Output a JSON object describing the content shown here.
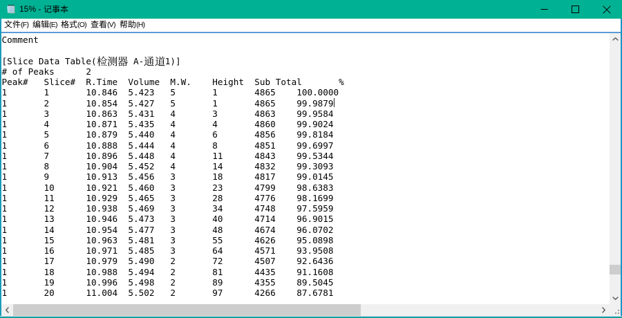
{
  "window": {
    "title": "15% - 记事本",
    "app_icon": "notepad-icon",
    "controls": {
      "minimize": "minimize",
      "maximize": "maximize",
      "close": "close"
    }
  },
  "menu": {
    "items": [
      {
        "label": "文件(F)"
      },
      {
        "label": "编辑(E)"
      },
      {
        "label": "格式(O)"
      },
      {
        "label": "查看(V)"
      },
      {
        "label": "帮助(H)"
      }
    ]
  },
  "editor": {
    "lines": [
      "Comment",
      "",
      "[Slice Data Table(检测器 A-通道1)]",
      "# of Peaks\t2",
      "Peak#\tSlice#\tR.Time\tVolume\tM.W.\tHeight\tSub Total\t%",
      "1\t1\t10.846\t5.423\t5\t1\t4865\t100.0000",
      "1\t2\t10.854\t5.427\t5\t1\t4865\t99.9879",
      "1\t3\t10.863\t5.431\t4\t3\t4863\t99.9584",
      "1\t4\t10.871\t5.435\t4\t4\t4860\t99.9024",
      "1\t5\t10.879\t5.440\t4\t6\t4856\t99.8184",
      "1\t6\t10.888\t5.444\t4\t8\t4851\t99.6997",
      "1\t7\t10.896\t5.448\t4\t11\t4843\t99.5344",
      "1\t8\t10.904\t5.452\t4\t14\t4832\t99.3093",
      "1\t9\t10.913\t5.456\t3\t18\t4817\t99.0145",
      "1\t10\t10.921\t5.460\t3\t23\t4799\t98.6383",
      "1\t11\t10.929\t5.465\t3\t28\t4776\t98.1699",
      "1\t12\t10.938\t5.469\t3\t34\t4748\t97.5959",
      "1\t13\t10.946\t5.473\t3\t40\t4714\t96.9015",
      "1\t14\t10.954\t5.477\t3\t48\t4674\t96.0702",
      "1\t15\t10.963\t5.481\t3\t55\t4626\t95.0898",
      "1\t16\t10.971\t5.485\t3\t64\t4571\t93.9508",
      "1\t17\t10.979\t5.490\t2\t72\t4507\t92.6436",
      "1\t18\t10.988\t5.494\t2\t81\t4435\t91.1608",
      "1\t19\t10.996\t5.498\t2\t89\t4355\t89.5045",
      "1\t20\t11.004\t5.502\t2\t97\t4266\t87.6781"
    ],
    "caret": {
      "line": 7,
      "col": 63
    },
    "tab_size": 8
  },
  "colors": {
    "titlebar": "#00B193",
    "title_text": "#000000",
    "border_left": "#1A9CB8",
    "border_right": "#1C96C6",
    "border_bottom": "#12A09B",
    "menu_separator": "#5B9BD5",
    "menu_bg": "#FFFFFF",
    "editor_bg": "#FFFFFF",
    "text": "#000000",
    "scroll_track": "#F0F0F0",
    "scroll_thumb": "#CDCDCD",
    "scroll_arrow": "#505050"
  }
}
